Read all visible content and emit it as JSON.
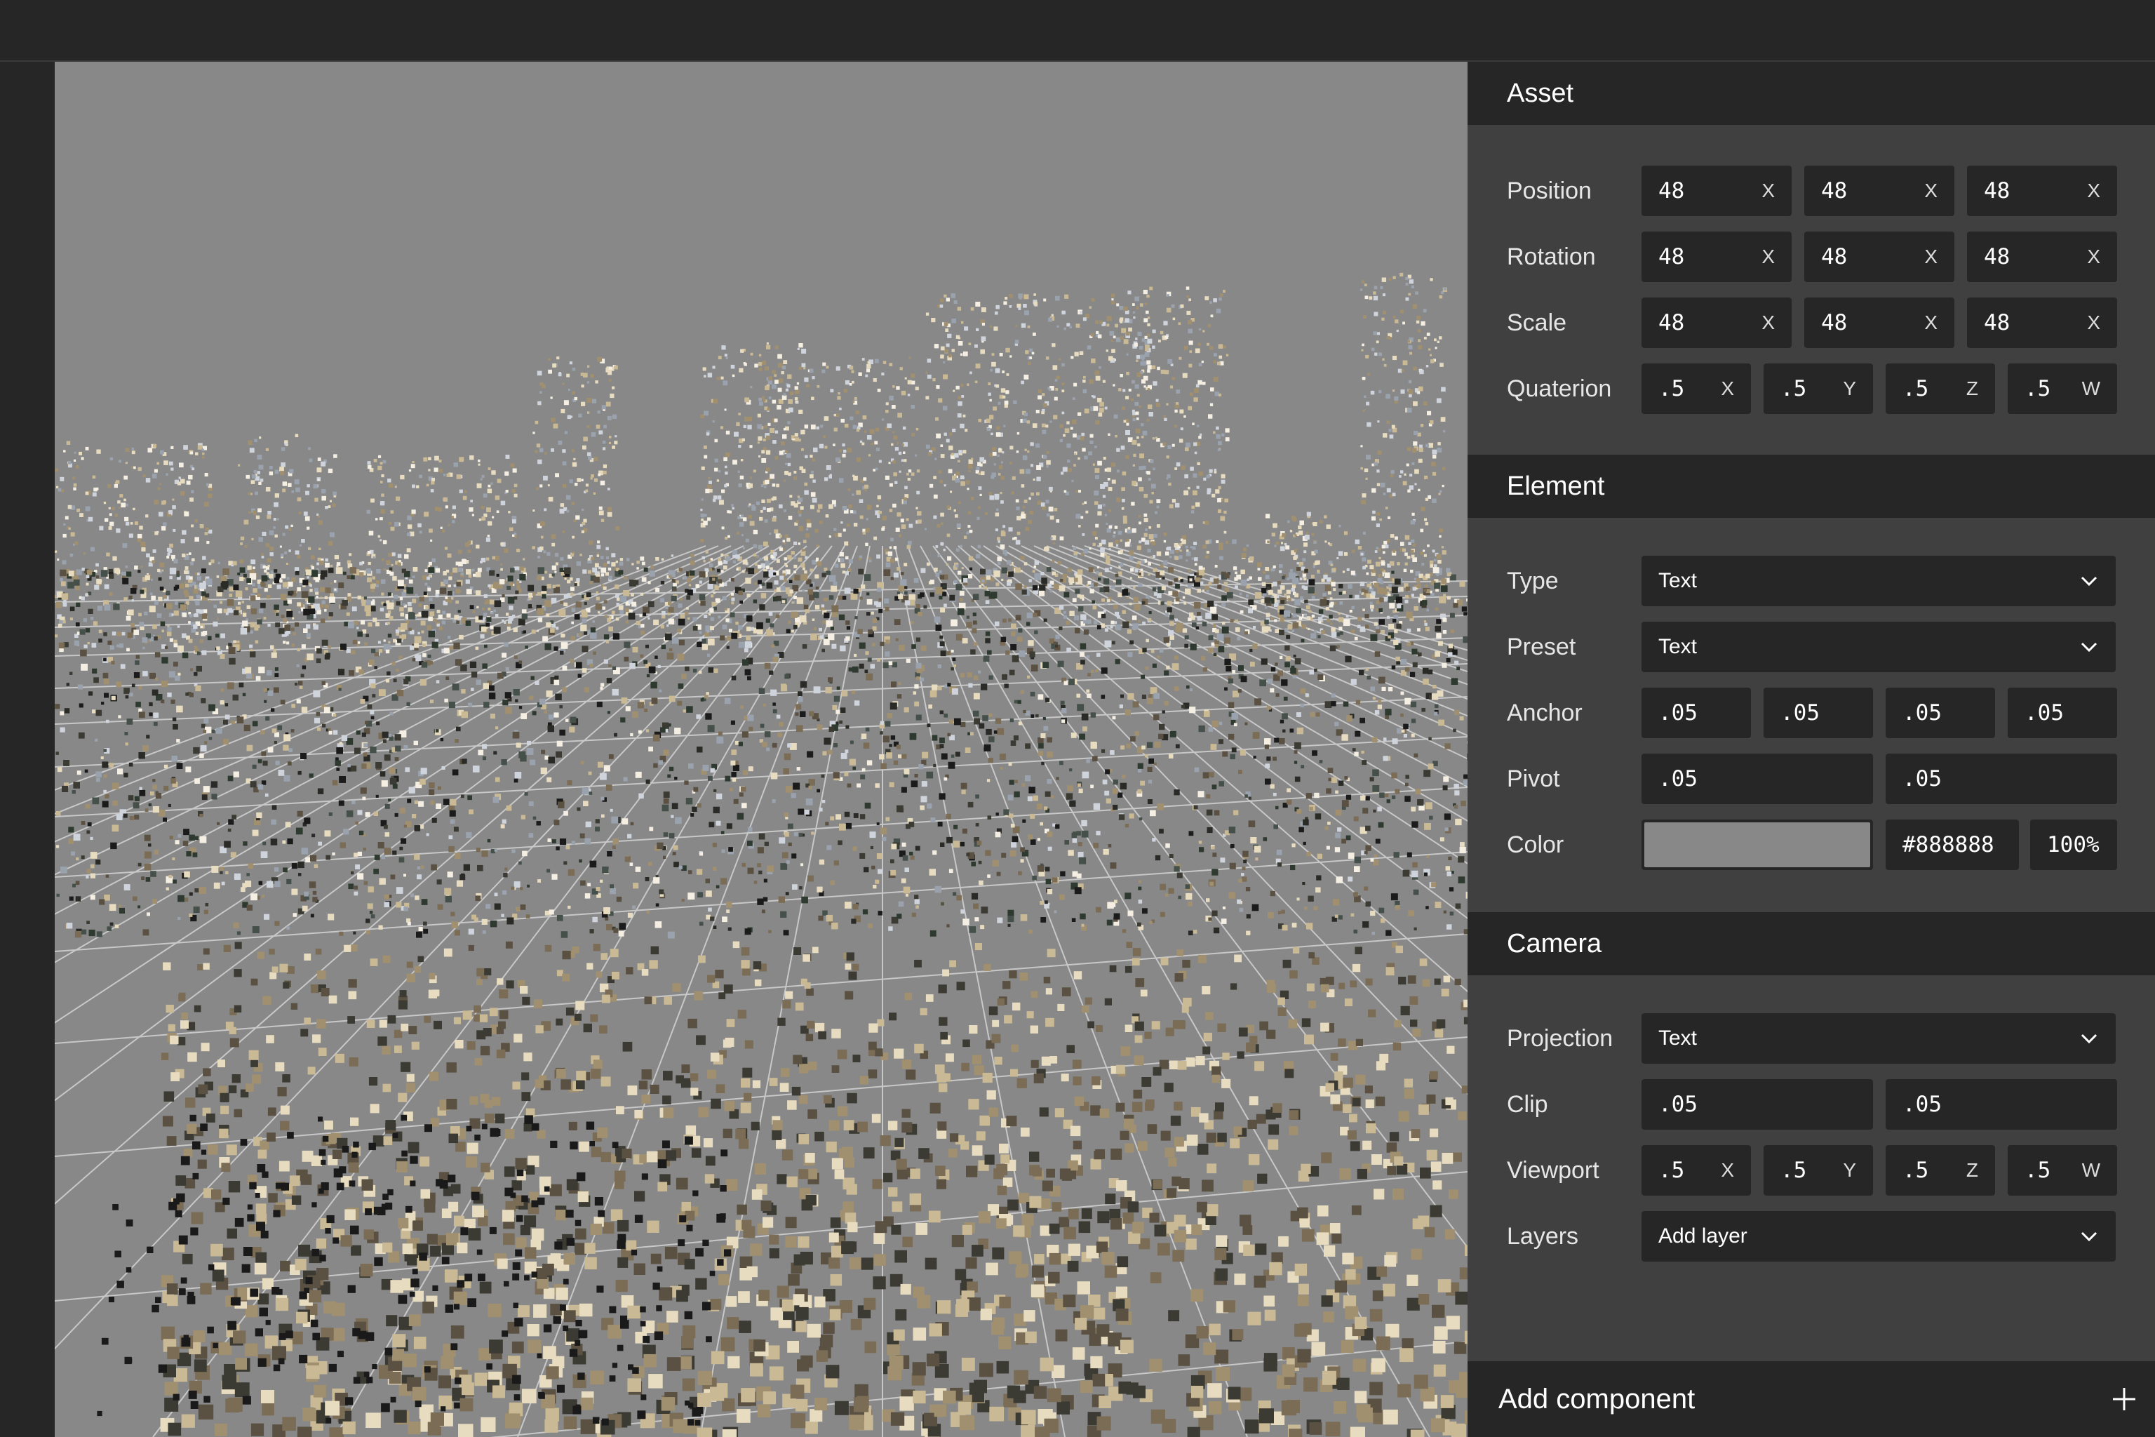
{
  "asset": {
    "title": "Asset",
    "position": {
      "label": "Position",
      "values": [
        "48",
        "48",
        "48"
      ],
      "axes": [
        "X",
        "X",
        "X"
      ]
    },
    "rotation": {
      "label": "Rotation",
      "values": [
        "48",
        "48",
        "48"
      ],
      "axes": [
        "X",
        "X",
        "X"
      ]
    },
    "scale": {
      "label": "Scale",
      "values": [
        "48",
        "48",
        "48"
      ],
      "axes": [
        "X",
        "X",
        "X"
      ]
    },
    "quaternion": {
      "label": "Quaterion",
      "values": [
        ".5",
        ".5",
        ".5",
        ".5"
      ],
      "axes": [
        "X",
        "Y",
        "Z",
        "W"
      ]
    }
  },
  "element": {
    "title": "Element",
    "type": {
      "label": "Type",
      "value": "Text"
    },
    "preset": {
      "label": "Preset",
      "value": "Text"
    },
    "anchor": {
      "label": "Anchor",
      "values": [
        ".05",
        ".05",
        ".05",
        ".05"
      ]
    },
    "pivot": {
      "label": "Pivot",
      "values": [
        ".05",
        ".05"
      ]
    },
    "color": {
      "label": "Color",
      "hex": "#888888",
      "opacity": "100%",
      "swatch": "#888888"
    }
  },
  "camera": {
    "title": "Camera",
    "projection": {
      "label": "Projection",
      "value": "Text"
    },
    "clip": {
      "label": "Clip",
      "values": [
        ".05",
        ".05"
      ]
    },
    "viewport": {
      "label": "Viewport",
      "values": [
        ".5",
        ".5",
        ".5",
        ".5"
      ],
      "axes": [
        "X",
        "Y",
        "Z",
        "W"
      ]
    },
    "layers": {
      "label": "Layers",
      "value": "Add layer"
    }
  },
  "footer": {
    "label": "Add component"
  },
  "colors": {
    "panel": "#404040",
    "header": "#262626",
    "field": "#262626",
    "viewport_bg": "#888888"
  }
}
